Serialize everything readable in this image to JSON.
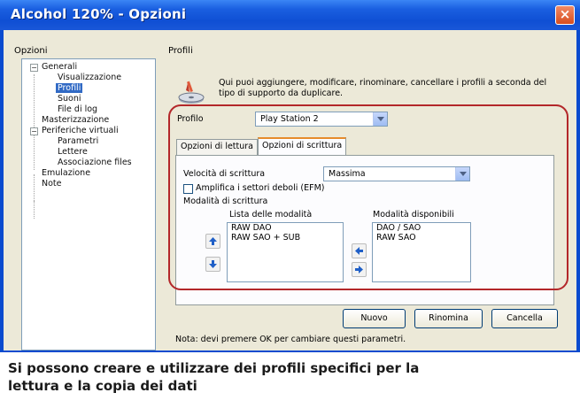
{
  "window": {
    "title": "Alcohol 120% - Opzioni",
    "close_glyph": "×"
  },
  "left_header": "Opzioni",
  "right_header": "Profili",
  "tree": {
    "items": [
      {
        "label": "Generali",
        "expander": "−"
      },
      {
        "label": "Visualizzazione"
      },
      {
        "label": "Profili",
        "selected": true
      },
      {
        "label": "Suoni"
      },
      {
        "label": "File di log"
      },
      {
        "label": "Masterizzazione"
      },
      {
        "label": "Periferiche virtuali",
        "expander": "−"
      },
      {
        "label": "Parametri"
      },
      {
        "label": "Lettere"
      },
      {
        "label": "Associazione files"
      },
      {
        "label": "Emulazione"
      },
      {
        "label": "Note"
      }
    ]
  },
  "profiles": {
    "description": "Qui puoi aggiungere, modificare, rinominare, cancellare i profili a seconda del tipo di supporto da duplicare.",
    "profile_label": "Profilo",
    "profile_value": "Play Station 2"
  },
  "tabs": [
    {
      "label": "Opzioni di lettura",
      "active": false
    },
    {
      "label": "Opzioni di scrittura",
      "active": true
    }
  ],
  "write_options": {
    "speed_label": "Velocità di scrittura",
    "speed_value": "Massima",
    "amplify_label": "Amplifica i settori deboli (EFM)",
    "amplify_checked": false,
    "modes_label": "Modalità di scrittura",
    "list_title": "Lista delle modalità",
    "list_items": [
      "RAW DAO",
      "RAW SAO + SUB"
    ],
    "available_title": "Modalità disponibili",
    "available_items": [
      "DAO / SAO",
      "RAW SAO"
    ]
  },
  "buttons": {
    "new": "Nuovo",
    "rename": "Rinomina",
    "delete": "Cancella"
  },
  "note": "Nota: devi premere OK per cambiare questi parametri.",
  "caption": "Si possono creare e utilizzare dei profili specifici per la lettura e la copia dei dati",
  "colors": {
    "titlebar": "#1a5fe0",
    "highlight": "#b3272a",
    "selection": "#316ac5"
  }
}
